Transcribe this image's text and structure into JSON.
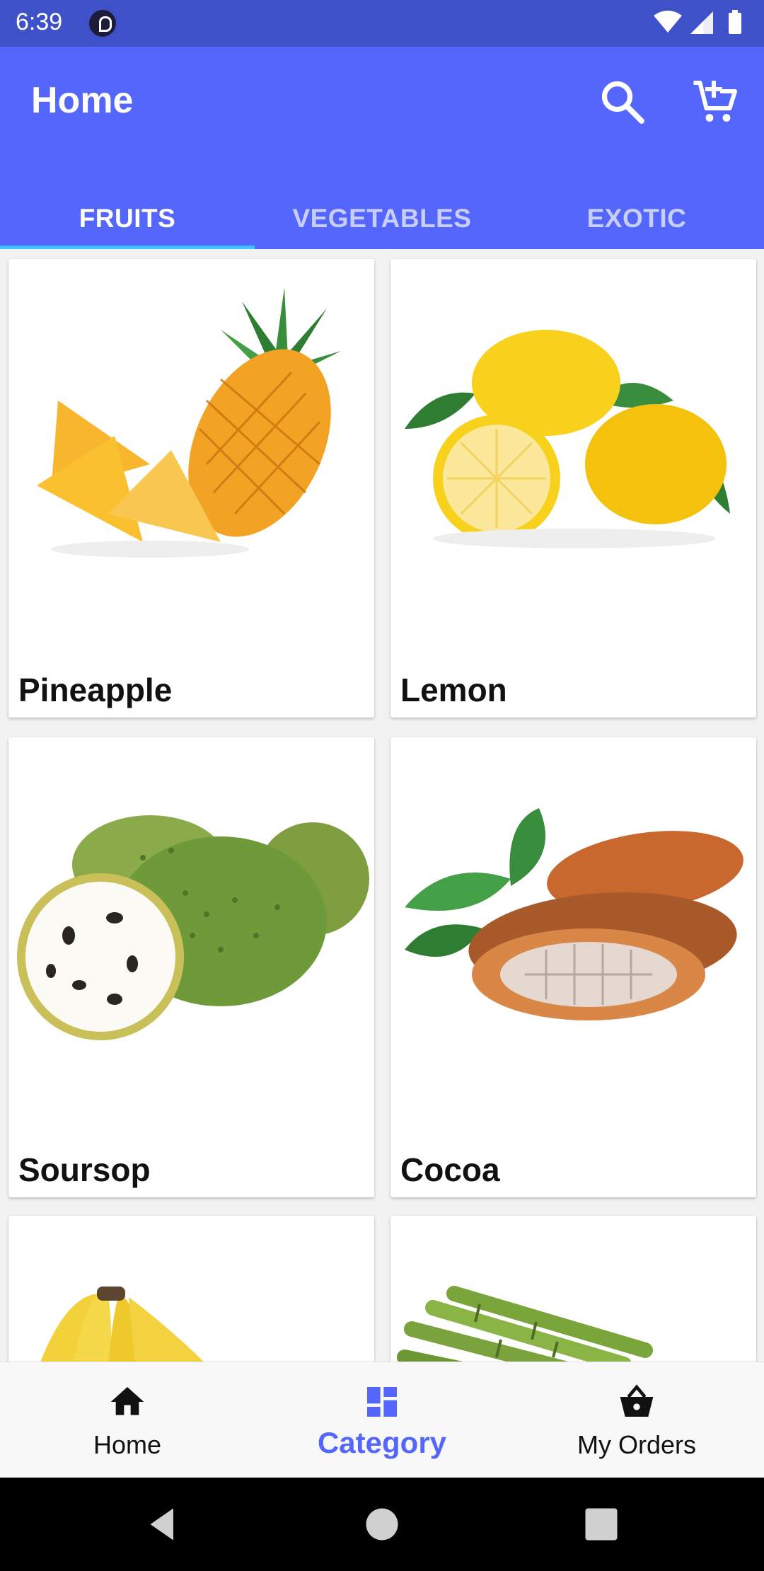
{
  "status_bar": {
    "time": "6:39"
  },
  "app_bar": {
    "title": "Home"
  },
  "tabs": [
    {
      "label": "FRUITS",
      "active": true
    },
    {
      "label": "VEGETABLES",
      "active": false
    },
    {
      "label": "EXOTIC",
      "active": false
    }
  ],
  "products": [
    {
      "name": "Pineapple"
    },
    {
      "name": "Lemon"
    },
    {
      "name": "Soursop"
    },
    {
      "name": "Cocoa"
    }
  ],
  "bottom_nav": [
    {
      "label": "Home",
      "icon": "home-icon",
      "active": false
    },
    {
      "label": "Category",
      "icon": "category-icon",
      "active": true
    },
    {
      "label": "My Orders",
      "icon": "basket-icon",
      "active": false
    }
  ],
  "colors": {
    "primary": "#5466fb",
    "status_bar": "#3f51c9",
    "tab_indicator": "#40c4ff"
  }
}
